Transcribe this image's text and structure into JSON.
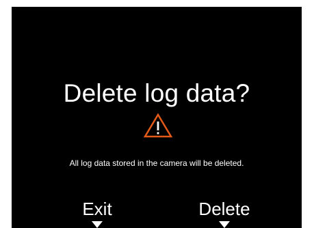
{
  "dialog": {
    "title": "Delete log data?",
    "warning_icon": "warning-triangle-icon",
    "message": "All log data stored in the camera will be deleted."
  },
  "softkeys": {
    "left_label": "Exit",
    "right_label": "Delete",
    "indicator_icon": "down-triangle-icon"
  },
  "colors": {
    "background": "#000000",
    "text": "#ffffff",
    "warning": "#e35a17"
  }
}
